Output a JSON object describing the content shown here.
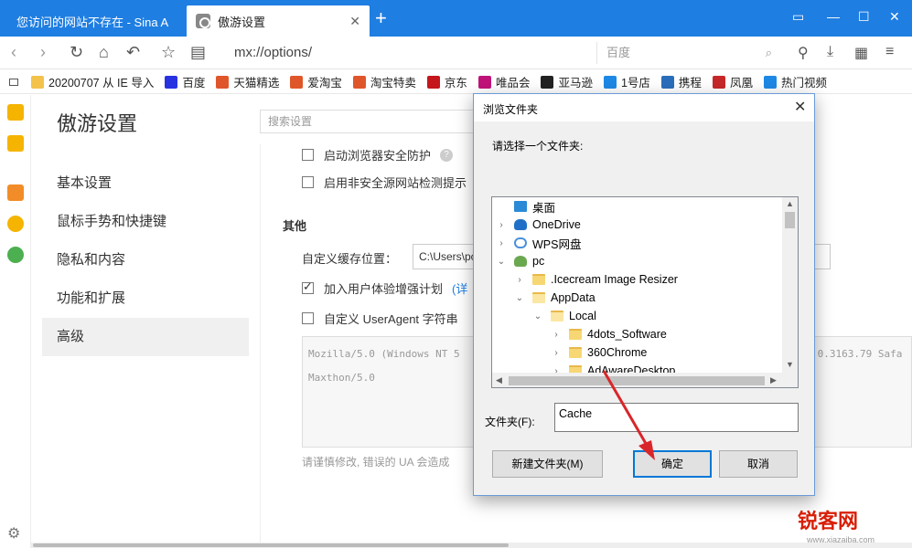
{
  "browser": {
    "tabs": [
      {
        "title": "您访问的网站不存在 - Sina A",
        "active": false
      },
      {
        "title": "傲游设置",
        "active": true
      }
    ],
    "new_tab_label": "+",
    "url": "mx://options/",
    "search_placeholder": "百度",
    "bookmarks": [
      {
        "label": "20200707 从 IE 导入",
        "icon_color": "#f2c24b"
      },
      {
        "label": "百度",
        "icon_color": "#2932e1"
      },
      {
        "label": "天猫精选",
        "icon_color": "#e0562b"
      },
      {
        "label": "爱淘宝",
        "icon_color": "#e0562b"
      },
      {
        "label": "淘宝特卖",
        "icon_color": "#e0562b"
      },
      {
        "label": "京东",
        "icon_color": "#c4161c"
      },
      {
        "label": "唯品会",
        "icon_color": "#c0137a"
      },
      {
        "label": "亚马逊",
        "icon_color": "#222222"
      },
      {
        "label": "1号店",
        "icon_color": "#1e88e5"
      },
      {
        "label": "携程",
        "icon_color": "#2a6ebb"
      },
      {
        "label": "凤凰",
        "icon_color": "#c62828"
      },
      {
        "label": "热门视频",
        "icon_color": "#1e88e5"
      }
    ]
  },
  "settings": {
    "title": "傲游设置",
    "search_placeholder": "搜索设置",
    "menu": [
      "基本设置",
      "鼠标手势和快捷键",
      "隐私和内容",
      "功能和扩展",
      "高级"
    ],
    "selected_menu": "高级",
    "opt_security": "启动浏览器安全防护",
    "opt_unsafe": "启用非安全源网站检测提示",
    "section_other": "其他",
    "cache_label": "自定义缓存位置：",
    "cache_value": "C:\\Users\\pc",
    "opt_ux": "加入用户体验增强计划",
    "opt_ux_link": "(详",
    "opt_ua": "自定义 UserAgent 字符串",
    "ua_line1": "Mozilla/5.0 (Windows NT 5",
    "ua_line1_right": ".0.3163.79 Safa",
    "ua_line2": "Maxthon/5.0",
    "warning": "请谨慎修改, 错误的 UA 会造成"
  },
  "dialog": {
    "title": "浏览文件夹",
    "prompt": "请选择一个文件夹:",
    "tree": [
      {
        "label": "桌面",
        "indent": 0,
        "icon": "desktop",
        "arrow": ""
      },
      {
        "label": "OneDrive",
        "indent": 0,
        "icon": "cloud",
        "arrow": "›"
      },
      {
        "label": "WPS网盘",
        "indent": 0,
        "icon": "wps",
        "arrow": "›"
      },
      {
        "label": "pc",
        "indent": 0,
        "icon": "user",
        "arrow": "⌄"
      },
      {
        "label": ".Icecream Image Resizer",
        "indent": 1,
        "icon": "folder",
        "arrow": "›"
      },
      {
        "label": "AppData",
        "indent": 1,
        "icon": "folder open",
        "arrow": "⌄"
      },
      {
        "label": "Local",
        "indent": 2,
        "icon": "folder open",
        "arrow": "⌄"
      },
      {
        "label": "4dots_Software",
        "indent": 3,
        "icon": "folder",
        "arrow": "›"
      },
      {
        "label": "360Chrome",
        "indent": 3,
        "icon": "folder",
        "arrow": "›"
      },
      {
        "label": "AdAwareDesktop",
        "indent": 3,
        "icon": "folder",
        "arrow": "›"
      }
    ],
    "folder_label": "文件夹(F):",
    "folder_value": "Cache",
    "new_folder_button": "新建文件夹(M)",
    "ok_button": "确定",
    "cancel_button": "取消"
  },
  "watermark": {
    "logo": "锐客网",
    "url": "www.xiazaiba.com"
  },
  "colors": {
    "tabbar": "#1f7ee1",
    "accent": "#0078d7",
    "arrow": "#d9262a"
  }
}
